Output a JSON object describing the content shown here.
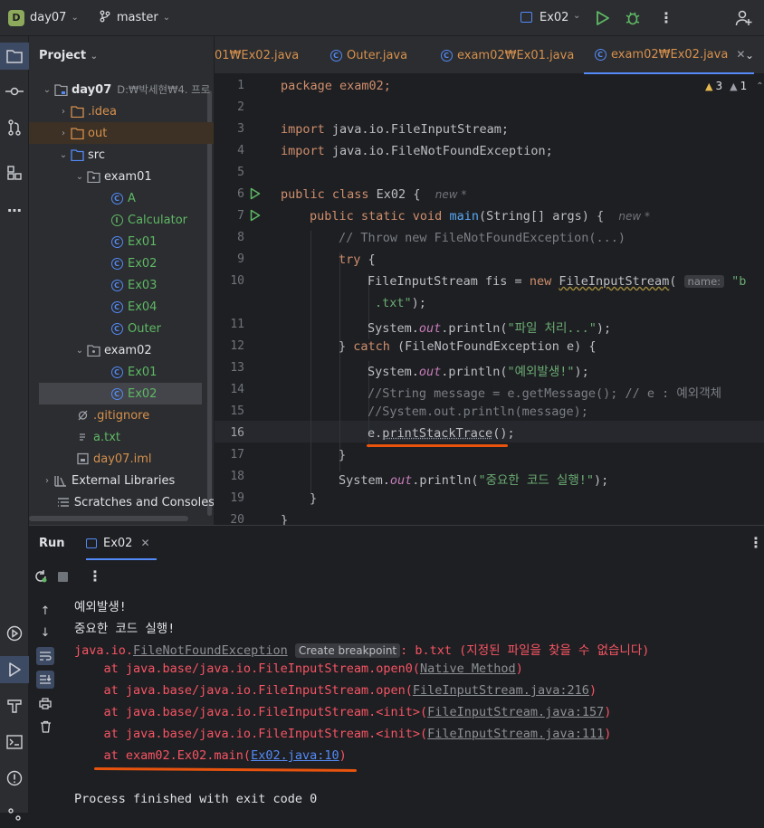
{
  "titlebar": {
    "project_badge": "D",
    "project_name": "day07",
    "branch": "master",
    "run_config": "Ex02"
  },
  "project_panel": {
    "title": "Project",
    "tree": [
      {
        "label": "day07",
        "suffix": "D:₩박세현₩4. 프로",
        "icon": "module-folder-icon"
      },
      {
        "label": ".idea",
        "icon": "folder-icon"
      },
      {
        "label": "out",
        "icon": "folder-icon"
      },
      {
        "label": "src",
        "icon": "source-folder-icon"
      },
      {
        "label": "exam01",
        "icon": "package-icon"
      },
      {
        "label": "A",
        "icon": "class-icon"
      },
      {
        "label": "Calculator",
        "icon": "interface-icon"
      },
      {
        "label": "Ex01",
        "icon": "runnable-class-icon"
      },
      {
        "label": "Ex02",
        "icon": "runnable-class-icon"
      },
      {
        "label": "Ex03",
        "icon": "runnable-class-icon"
      },
      {
        "label": "Ex04",
        "icon": "runnable-class-icon"
      },
      {
        "label": "Outer",
        "icon": "class-icon"
      },
      {
        "label": "exam02",
        "icon": "package-icon"
      },
      {
        "label": "Ex01",
        "icon": "runnable-class-icon"
      },
      {
        "label": "Ex02",
        "icon": "runnable-class-icon"
      },
      {
        "label": ".gitignore",
        "icon": "gitignore-icon"
      },
      {
        "label": "a.txt",
        "icon": "text-file-icon"
      },
      {
        "label": "day07.iml",
        "icon": "iml-file-icon"
      },
      {
        "label": "External Libraries",
        "icon": "library-icon"
      },
      {
        "label": "Scratches and Consoles",
        "icon": "scratches-icon"
      }
    ]
  },
  "editor": {
    "tabs": [
      {
        "label": "01₩Ex02.java"
      },
      {
        "label": "Outer.java"
      },
      {
        "label": "exam02₩Ex01.java"
      },
      {
        "label": "exam02₩Ex02.java"
      }
    ],
    "warnings": "3",
    "weak_warnings": "1",
    "hint_new": "new *",
    "param_name": "name:",
    "line_numbers": [
      "1",
      "2",
      "3",
      "4",
      "5",
      "6",
      "7",
      "8",
      "9",
      "10",
      "",
      "11",
      "12",
      "13",
      "14",
      "15",
      "16",
      "17",
      "18",
      "19",
      "20"
    ],
    "lines": {
      "l1": "package exam02;",
      "l3a": "import",
      "l3b": " java.io.FileInputStream;",
      "l4a": "import",
      "l4b": " java.io.FileNotFoundException;",
      "l6a": "public class",
      "l6b": " Ex02 {",
      "l7a": "public static void ",
      "l7b": "main",
      "l7c": "(String[] args) {",
      "l8": "// Throw new FileNotFoundException(...)",
      "l9a": "try",
      "l9b": " {",
      "l10a": "FileInputStream fis = ",
      "l10b": "new ",
      "l10c": "FileInputStream",
      "l10d": "(",
      "l10e": "\"b",
      "l10f": ".txt\"",
      "l10g": ");",
      "l11a": "System.",
      "l11b": "out",
      "l11c": ".println(",
      "l11d": "\"파일 처리...\"",
      "l11e": ");",
      "l12a": "} ",
      "l12b": "catch",
      "l12c": " (FileNotFoundException e) {",
      "l13a": "System.",
      "l13b": "out",
      "l13c": ".println(",
      "l13d": "\"예외발생!\"",
      "l13e": ");",
      "l14": "//String message = e.getMessage(); // e : 예외객체",
      "l15": "//System.out.println(message);",
      "l16a": "e.",
      "l16b": "printStackTrace",
      "l16c": "();",
      "l17": "}",
      "l18a": "System.",
      "l18b": "out",
      "l18c": ".println(",
      "l18d": "\"중요한 코드 실행!\"",
      "l18e": ");",
      "l19": "}",
      "l20": "}"
    }
  },
  "run": {
    "title": "Run",
    "tab": "Ex02",
    "output": {
      "o1": "예외발생!",
      "o2": "중요한 코드 실행!",
      "o3a": "java.io.",
      "o3b": "FileNotFoundException",
      "o3c": "Create breakpoint",
      "o3d": ": b.txt (지정된 파일을 찾을 수 없습니다)",
      "o4a": "    at java.base/java.io.FileInputStream.open0(",
      "o4b": "Native Method",
      "o4c": ")",
      "o5a": "    at java.base/java.io.FileInputStream.open(",
      "o5b": "FileInputStream.java:216",
      "o5c": ")",
      "o6a": "    at java.base/java.io.FileInputStream.<init>(",
      "o6b": "FileInputStream.java:157",
      "o6c": ")",
      "o7a": "    at java.base/java.io.FileInputStream.<init>(",
      "o7b": "FileInputStream.java:111",
      "o7c": ")",
      "o8a": "    at exam02.Ex02.main(",
      "o8b": "Ex02.java:10",
      "o8c": ")",
      "o9": "Process finished with exit code 0"
    }
  },
  "colors": {
    "accent": "#548af7",
    "error": "#f75464",
    "annotation": "#e8530e",
    "success": "#5fb865"
  }
}
